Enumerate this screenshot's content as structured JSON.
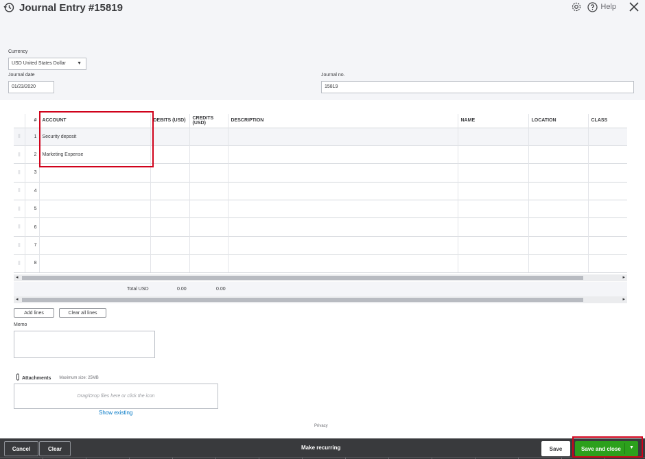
{
  "header": {
    "title": "Journal Entry #15819",
    "help_label": "Help",
    "currency_label": "Currency",
    "currency_value": "USD United States Dollar",
    "journal_date_label": "Journal date",
    "journal_date_value": "01/23/2020",
    "journal_no_label": "Journal no.",
    "journal_no_value": "15819"
  },
  "grid": {
    "columns": [
      "#",
      "ACCOUNT",
      "DEBITS (USD)",
      "CREDITS (USD)",
      "DESCRIPTION",
      "NAME",
      "LOCATION",
      "CLASS"
    ],
    "rows": [
      {
        "num": "1",
        "account": "Security deposit"
      },
      {
        "num": "2",
        "account": "Marketing Expense"
      },
      {
        "num": "3",
        "account": ""
      },
      {
        "num": "4",
        "account": ""
      },
      {
        "num": "5",
        "account": ""
      },
      {
        "num": "6",
        "account": ""
      },
      {
        "num": "7",
        "account": ""
      },
      {
        "num": "8",
        "account": ""
      }
    ],
    "total_label": "Total USD",
    "total_debits": "0.00",
    "total_credits": "0.00"
  },
  "buttons": {
    "add_lines": "Add lines",
    "clear_all_lines": "Clear all lines"
  },
  "memo_label": "Memo",
  "attachments": {
    "label": "Attachments",
    "max_size": "Maximum size: 25MB",
    "drop_text": "Drag/Drop files here or click the icon",
    "show_existing": "Show existing"
  },
  "privacy": "Privacy",
  "footer": {
    "cancel": "Cancel",
    "clear": "Clear",
    "make_recurring": "Make recurring",
    "save": "Save",
    "save_and_close": "Save and close"
  },
  "colors": {
    "primary_green": "#2ca01c",
    "link_blue": "#0077c5",
    "footer_bg": "#393a3d",
    "highlight_red": "#d0021b"
  }
}
